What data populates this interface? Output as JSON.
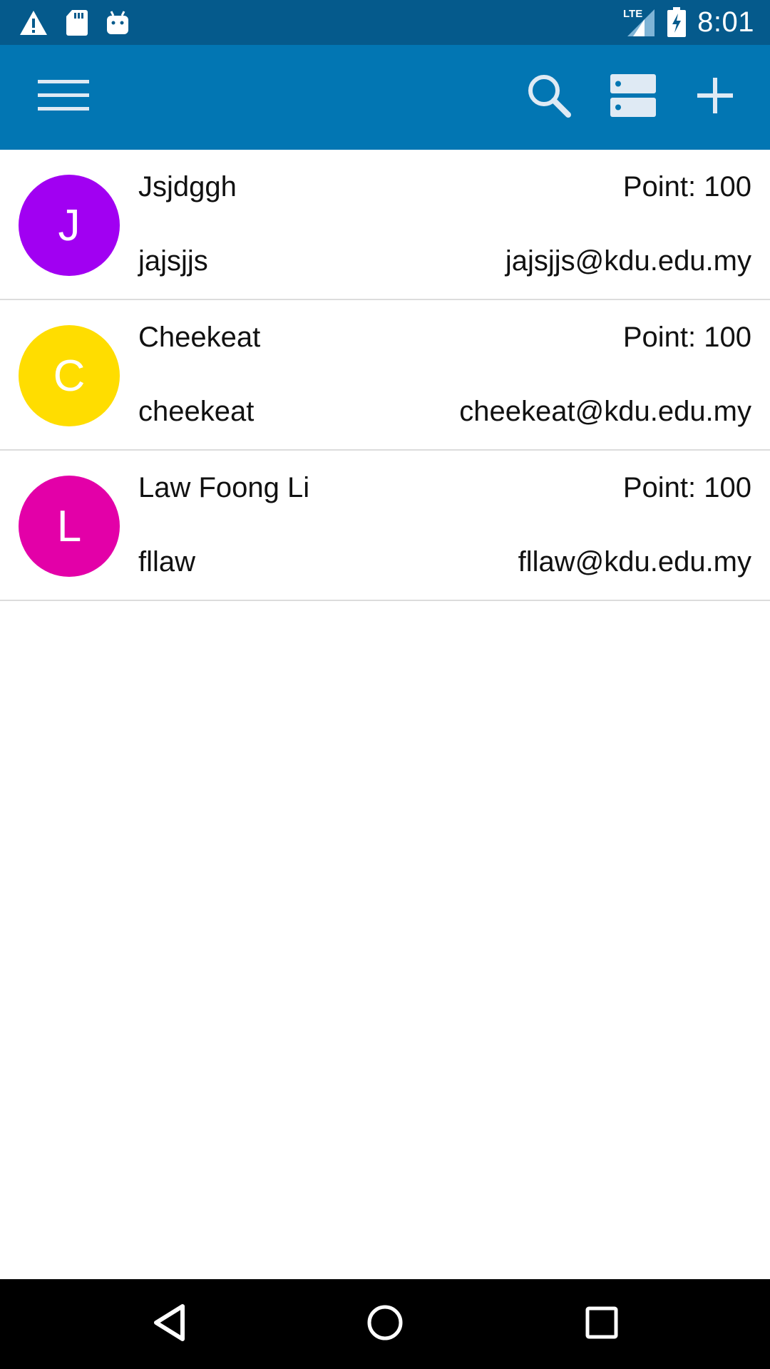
{
  "status_bar": {
    "time": "8:01",
    "network": "LTE",
    "left_icons": [
      "warning-icon",
      "sd-card-icon",
      "android-icon"
    ],
    "right_icons": [
      "signal-icon",
      "battery-charging-icon"
    ]
  },
  "app_bar": {
    "actions": [
      "menu-icon",
      "search-icon",
      "storage-icon",
      "add-icon"
    ],
    "color": "#0276b3"
  },
  "users": [
    {
      "initial": "J",
      "name": "Jsjdggh",
      "points": "Point: 100",
      "username": "jajsjjs",
      "email": "jajsjjs@kdu.edu.my",
      "color": "#a100f2"
    },
    {
      "initial": "C",
      "name": "Cheekeat",
      "points": "Point: 100",
      "username": "cheekeat",
      "email": "cheekeat@kdu.edu.my",
      "color": "#ffdd00"
    },
    {
      "initial": "L",
      "name": "Law Foong Li",
      "points": "Point: 100",
      "username": "fllaw",
      "email": "fllaw@kdu.edu.my",
      "color": "#e300a8"
    }
  ],
  "nav_bar": {
    "buttons": [
      "back-icon",
      "home-icon",
      "recents-icon"
    ]
  }
}
